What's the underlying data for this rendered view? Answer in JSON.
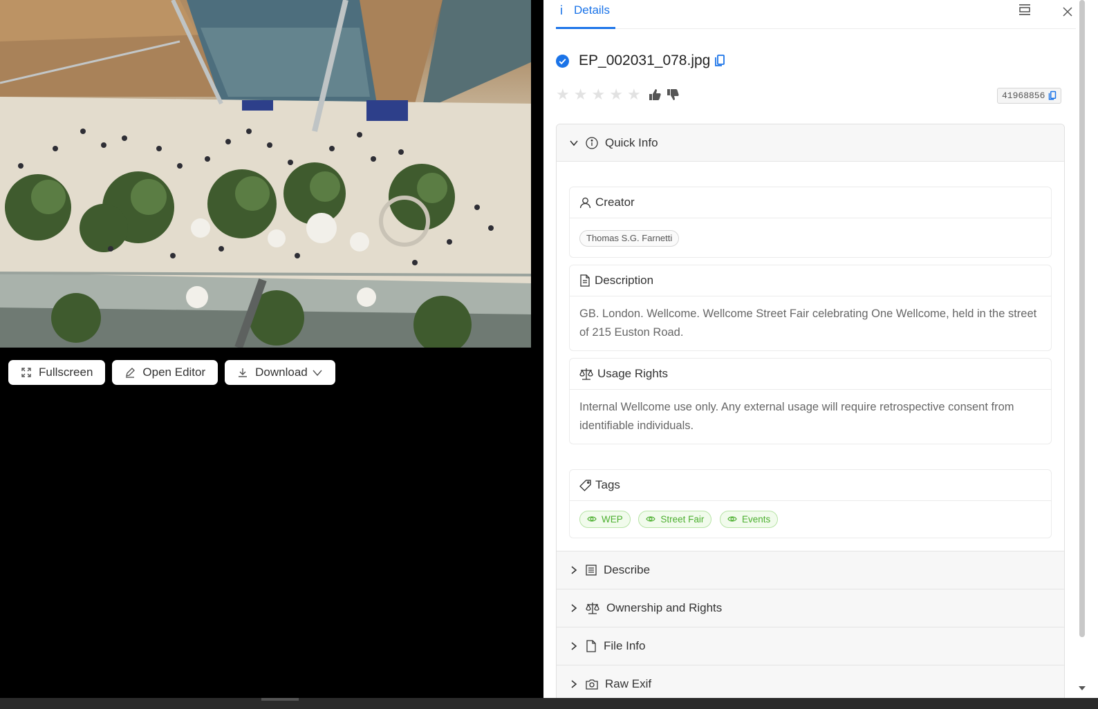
{
  "viewer": {
    "buttons": [
      {
        "label": "Fullscreen"
      },
      {
        "label": "Open Editor"
      },
      {
        "label": "Download"
      }
    ]
  },
  "tabs": {
    "details_icon": "i",
    "details_label": "Details"
  },
  "file": {
    "name": "EP_002031_078.jpg",
    "id": "41968856"
  },
  "quick_info": {
    "title": "Quick Info",
    "creator": {
      "title": "Creator",
      "name": "Thomas S.G. Farnetti"
    },
    "description": {
      "title": "Description",
      "text": "GB. London. Wellcome. Wellcome Street Fair celebrating One Wellcome, held in the street of 215 Euston Road."
    },
    "usage_rights": {
      "title": "Usage Rights",
      "text": "Internal Wellcome use only. Any external usage will require retrospective consent from identifiable individuals."
    },
    "tags": {
      "title": "Tags",
      "items": [
        "WEP",
        "Street Fair",
        "Events"
      ]
    }
  },
  "sections": [
    {
      "label": "Describe"
    },
    {
      "label": "Ownership and Rights"
    },
    {
      "label": "File Info"
    },
    {
      "label": "Raw Exif"
    }
  ],
  "colors": {
    "accent": "#1a73e8",
    "tag_green": "#4caf2f"
  }
}
